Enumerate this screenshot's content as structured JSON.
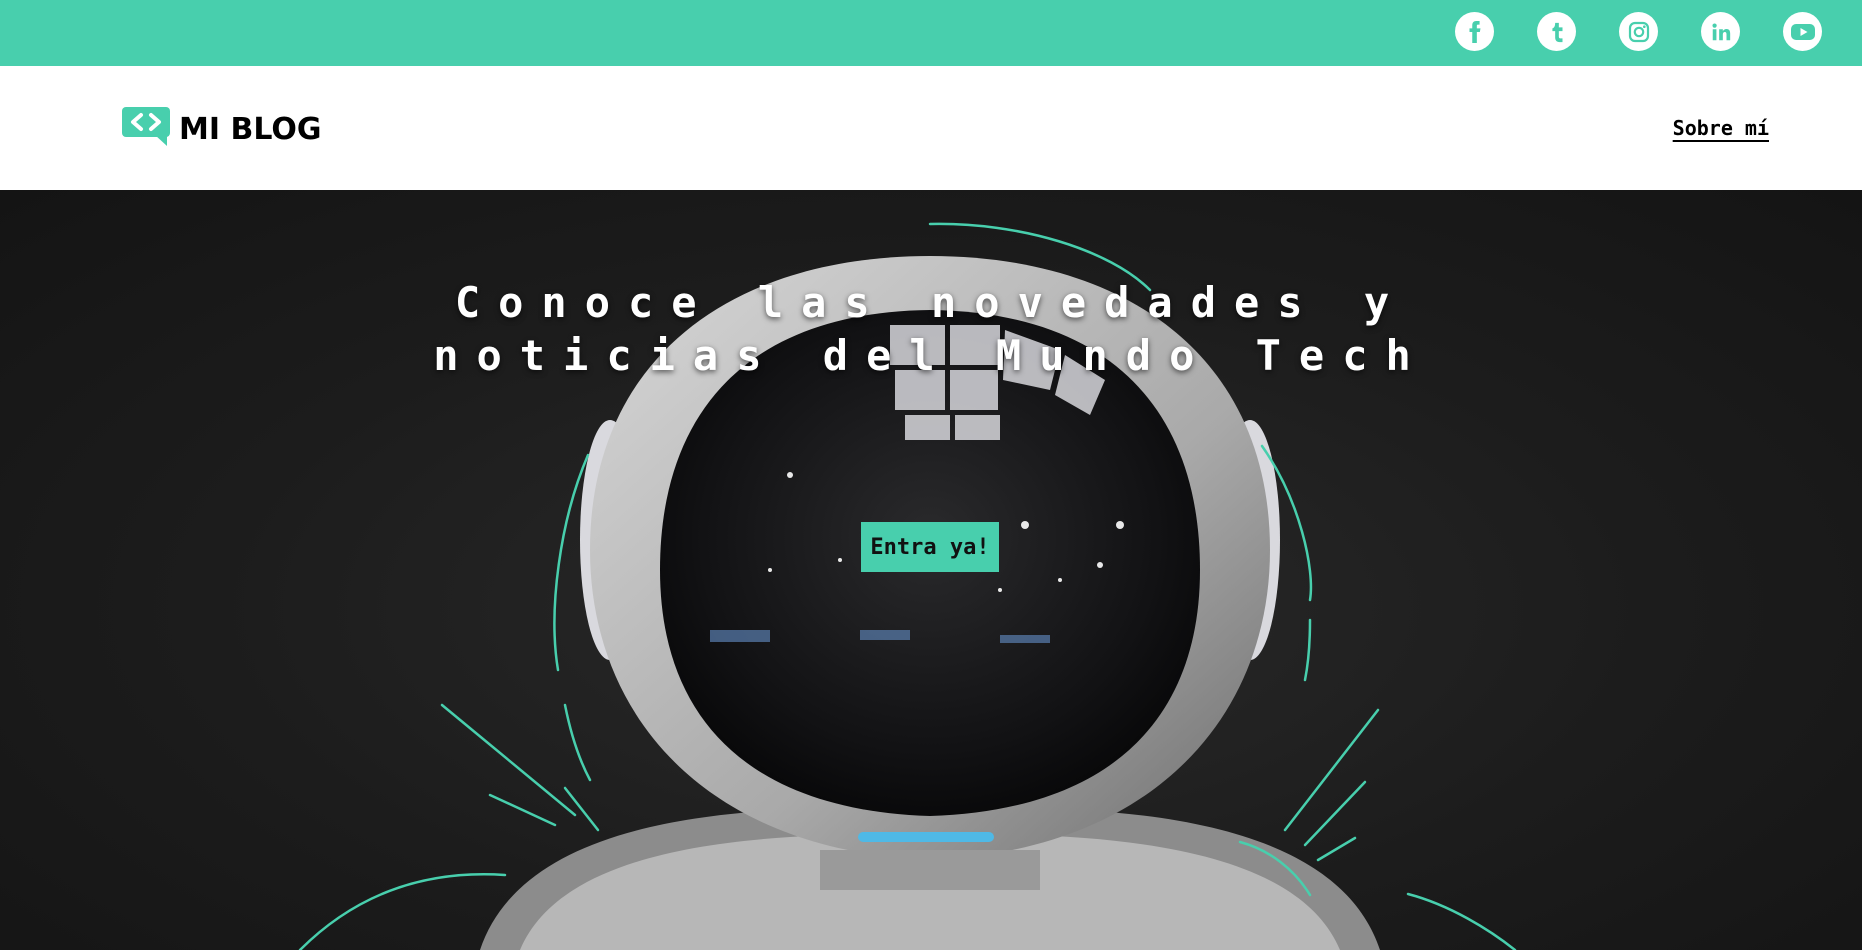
{
  "brand": {
    "name": "MI BLOG",
    "accent_color": "#48cfad"
  },
  "social": [
    {
      "name": "facebook",
      "icon": "facebook-icon"
    },
    {
      "name": "tumblr",
      "icon": "tumblr-icon"
    },
    {
      "name": "instagram",
      "icon": "instagram-icon"
    },
    {
      "name": "linkedin",
      "icon": "linkedin-icon"
    },
    {
      "name": "youtube",
      "icon": "youtube-icon"
    }
  ],
  "nav": {
    "about_label": "Sobre mí"
  },
  "hero": {
    "title_line1": "Conoce las novedades y",
    "title_line2": "noticias del Mundo Tech",
    "cta_label": "Entra ya!"
  }
}
